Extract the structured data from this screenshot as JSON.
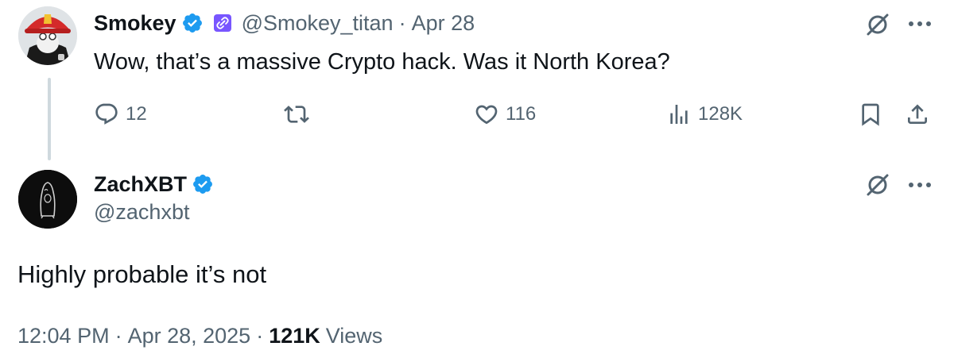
{
  "tweet1": {
    "display_name": "Smokey",
    "handle": "@Smokey_titan",
    "separator": "·",
    "date": "Apr 28",
    "text": "Wow, that’s a massive Crypto hack. Was it North Korea?",
    "replies": "12",
    "likes": "116",
    "views": "128K"
  },
  "tweet2": {
    "display_name": "ZachXBT",
    "handle": "@zachxbt",
    "text": "Highly probable it’s not",
    "time": "12:04 PM",
    "date": "Apr 28, 2025",
    "separator": "·",
    "views_count": "121K",
    "views_label": "Views"
  },
  "icons": {
    "verified": "verified-badge-icon",
    "affiliate": "affiliate-badge-icon",
    "grok": "grok-icon",
    "more": "more-icon",
    "reply": "reply-icon",
    "retweet": "retweet-icon",
    "like": "heart-icon",
    "views": "views-icon",
    "bookmark": "bookmark-icon",
    "share": "share-icon"
  },
  "colors": {
    "verified": "#1d9bf0",
    "affiliate": "#7856ff",
    "primary_text": "#0f1419",
    "secondary_text": "#536471",
    "thread_line": "#cfd9de"
  }
}
